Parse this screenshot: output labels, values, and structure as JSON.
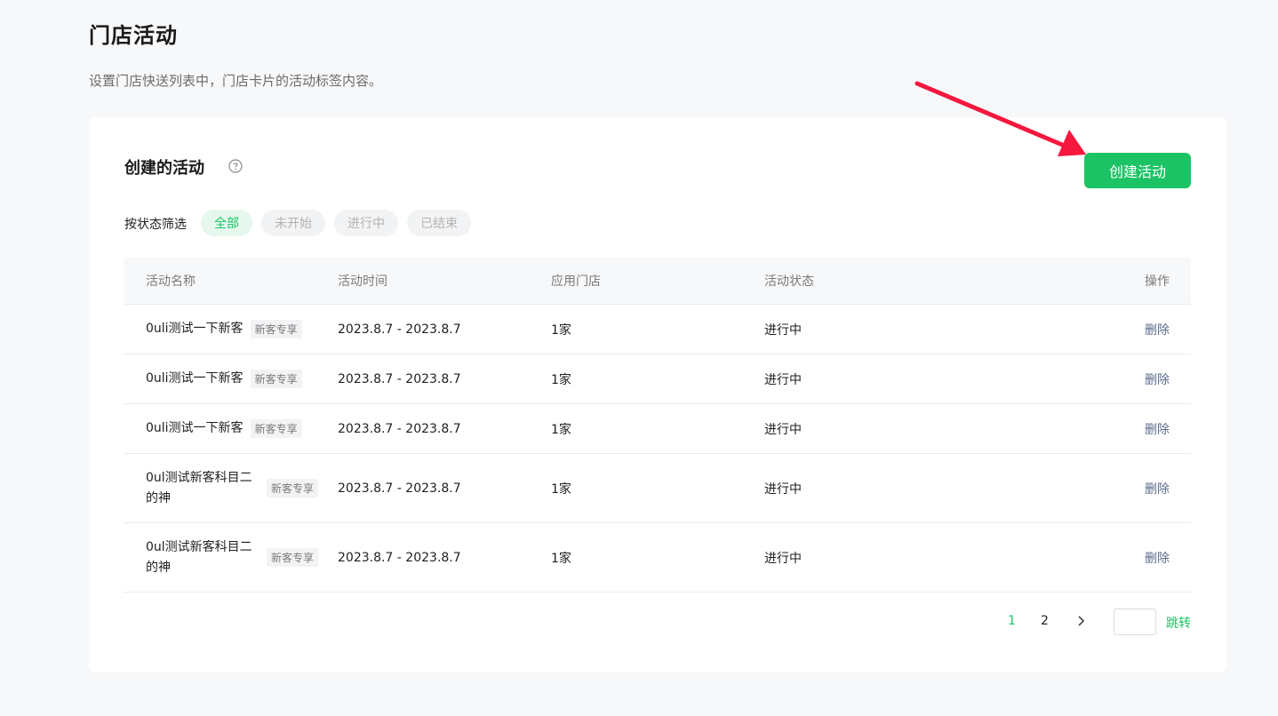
{
  "page": {
    "title": "门店活动",
    "description": "设置门店快送列表中，门店卡片的活动标签内容。"
  },
  "card": {
    "title": "创建的活动",
    "help_icon": "question-circle-icon",
    "create_button": "创建活动"
  },
  "filter": {
    "label": "按状态筛选",
    "options": [
      {
        "label": "全部",
        "active": true
      },
      {
        "label": "未开始",
        "active": false
      },
      {
        "label": "进行中",
        "active": false
      },
      {
        "label": "已结束",
        "active": false
      }
    ]
  },
  "table": {
    "columns": [
      "活动名称",
      "活动时间",
      "应用门店",
      "活动状态",
      "操作"
    ],
    "rows": [
      {
        "name": "0uli测试一下新客",
        "tag": "新客专享",
        "time": "2023.8.7 - 2023.8.7",
        "stores": "1家",
        "status": "进行中",
        "action": "删除"
      },
      {
        "name": "0uli测试一下新客",
        "tag": "新客专享",
        "time": "2023.8.7 - 2023.8.7",
        "stores": "1家",
        "status": "进行中",
        "action": "删除"
      },
      {
        "name": "0uli测试一下新客",
        "tag": "新客专享",
        "time": "2023.8.7 - 2023.8.7",
        "stores": "1家",
        "status": "进行中",
        "action": "删除"
      },
      {
        "name": "0ul测试新客科目二的神",
        "tag": "新客专享",
        "time": "2023.8.7 - 2023.8.7",
        "stores": "1家",
        "status": "进行中",
        "action": "删除"
      },
      {
        "name": "0ul测试新客科目二的神",
        "tag": "新客专享",
        "time": "2023.8.7 - 2023.8.7",
        "stores": "1家",
        "status": "进行中",
        "action": "删除"
      }
    ]
  },
  "pagination": {
    "pages": [
      "1",
      "2"
    ],
    "current": "1",
    "next_icon": "chevron-right-icon",
    "jump_value": "",
    "jump_label": "跳转"
  },
  "colors": {
    "accent": "#1cc364",
    "annotation_arrow": "#f5173d"
  }
}
